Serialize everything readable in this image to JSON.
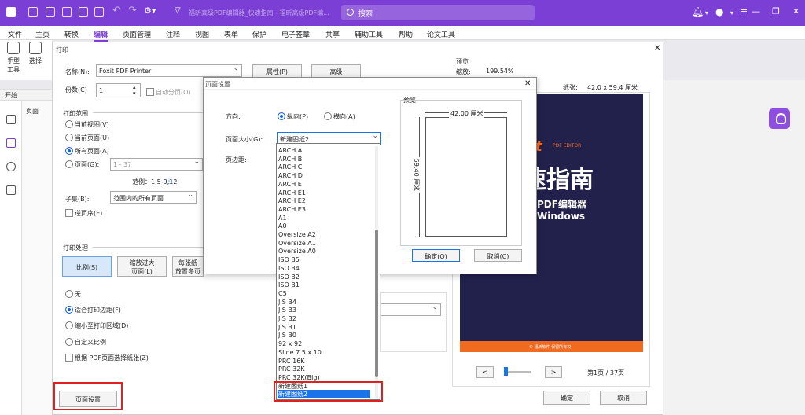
{
  "titlebar": {
    "title": "福昕高级PDF编辑器_快速指南 - 福昕高级PDF编...",
    "search_placeholder": "搜索"
  },
  "menu": [
    "文件",
    "主页",
    "转换",
    "编辑",
    "页面管理",
    "注释",
    "视图",
    "表单",
    "保护",
    "电子签章",
    "共享",
    "辅助工具",
    "帮助",
    "论文工具"
  ],
  "menu_active": "编辑",
  "tools": {
    "hand": "手型\n工具",
    "select": "选择"
  },
  "start_label": "开始",
  "pages_label": "页面",
  "print": {
    "title": "打印",
    "name_label": "名称(N):",
    "printer": "Foxit PDF Printer",
    "props_btn": "属性(P)",
    "advanced_btn": "高级",
    "copies_label": "份数(C)",
    "copies": "1",
    "collate": "自动分页(O)",
    "range_title": "打印范围",
    "current_view": "当前视图(V)",
    "current_page": "当前页面(U)",
    "all_pages": "所有页面(A)",
    "pages": "页面(G):",
    "pages_value": "1 - 37",
    "example": "范例：1,5-9,12",
    "subset_label": "子集(B):",
    "subset": "范围内的所有页面",
    "reverse": "逆页序(E)",
    "handling_title": "打印处理",
    "tab_scale": "比例(S)",
    "tab_fit": "缩放过大\n页面(L)",
    "tab_multi": "每张纸\n放置多页",
    "opt_none": "无",
    "opt_fit_margins": "适合打印边距(F)",
    "opt_shrink": "缩小至打印区域(D)",
    "opt_custom": "自定义比例",
    "opt_paper_by_size": "根据 PDF页面选择纸张(Z)",
    "page_setup_btn": "页面设置",
    "preview_title": "预览",
    "zoom_label": "缩放:",
    "zoom": "199.54%",
    "paper_label": "纸张:",
    "paper": "42.0 x 59.4 厘米",
    "nav_prev": "<",
    "nav_next": ">",
    "page_status": "第1页 / 37页",
    "ok_btn": "确定",
    "cancel_btn": "取消",
    "cover": {
      "brand": "oxit",
      "brand_sub": "PDF EDITOR",
      "headline": "速指南",
      "line1": "级PDF编辑器",
      "line2": "于Windows",
      "footer": "© 福昕软件 保留所有权"
    }
  },
  "page_setup": {
    "title": "页面设置",
    "orientation_label": "方向:",
    "portrait": "纵向(P)",
    "landscape": "横向(A)",
    "size_label": "页面大小(G):",
    "size_value": "新建图纸2",
    "margins_label": "页边距:",
    "preview_title": "预览",
    "width_dim": "42.00 厘米",
    "height_dim": "59.40 厘米",
    "ok_btn": "确定(O)",
    "cancel_btn": "取消(C)",
    "options": [
      "ARCH A",
      "ARCH B",
      "ARCH C",
      "ARCH D",
      "ARCH E",
      "ARCH E1",
      "ARCH E2",
      "ARCH E3",
      "A1",
      "A0",
      "Oversize A2",
      "Oversize A1",
      "Oversize A0",
      "ISO B5",
      "ISO B4",
      "ISO B2",
      "ISO B1",
      "C5",
      "JIS B4",
      "JIS B3",
      "JIS B2",
      "JIS B1",
      "JIS B0",
      "92 x 92",
      "Slide 7.5 x 10",
      "PRC 16K",
      "PRC 32K",
      "PRC 32K(Big)",
      "新建图纸1",
      "新建图纸2"
    ],
    "selected_option": "新建图纸2"
  },
  "colors": {
    "accent": "#7c3fd6",
    "selection": "#1a73e8",
    "highlight": "#e02020"
  }
}
